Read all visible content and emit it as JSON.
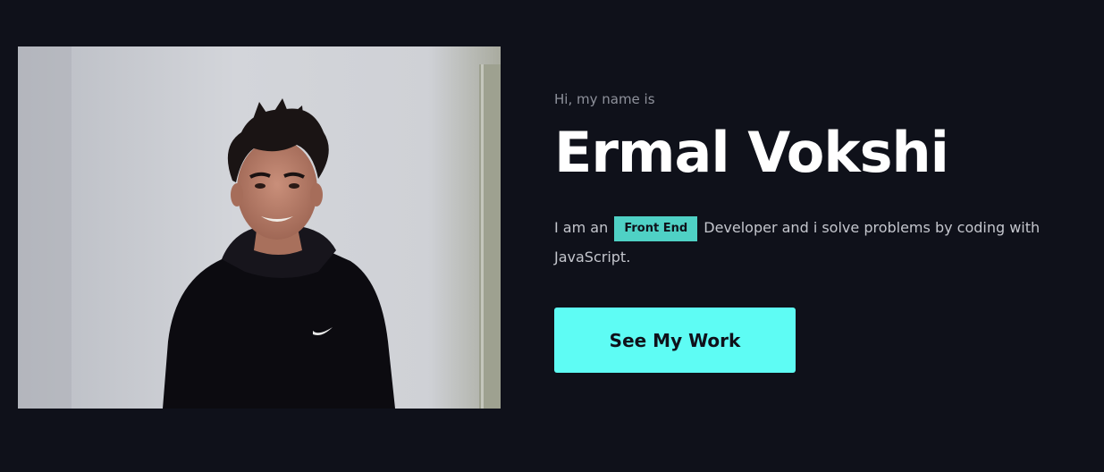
{
  "hero": {
    "photo_alt": "Portrait photo",
    "greeting": "Hi, my name is",
    "name": "Ermal Vokshi",
    "tagline_before": "I am an",
    "tagline_highlight": "Front End",
    "tagline_after": "Developer and i solve problems by coding with JavaScript.",
    "cta_label": "See My Work"
  },
  "colors": {
    "background": "#0f111a",
    "accent": "#5efcf4",
    "highlight": "#4fd1c5",
    "heading": "#ffffff",
    "muted_text": "#8e919b"
  }
}
